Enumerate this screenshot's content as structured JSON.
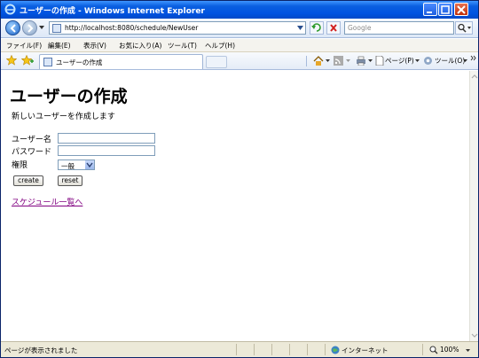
{
  "window": {
    "title": "ユーザーの作成 - Windows Internet Explorer"
  },
  "address_bar": {
    "url": "http://localhost:8080/schedule/NewUser",
    "search_placeholder": "Google"
  },
  "menu": {
    "items": [
      "ファイル(F)",
      "編集(E)",
      "表示(V)",
      "お気に入り(A)",
      "ツール(T)",
      "ヘルプ(H)"
    ]
  },
  "tab": {
    "label": "ユーザーの作成"
  },
  "commandbar": {
    "page_label": "ページ(P)",
    "tools_label": "ツール(O)"
  },
  "page": {
    "heading": "ユーザーの作成",
    "subtitle": "新しいユーザーを作成します",
    "form": {
      "username_label": "ユーザー名",
      "password_label": "パスワード",
      "role_label": "権限",
      "role_value": "一般",
      "create_label": "create",
      "reset_label": "reset"
    },
    "schedule_link": "スケジュール一覧へ"
  },
  "statusbar": {
    "text": "ページが表示されました",
    "zone": "インターネット",
    "zoom": "100%"
  }
}
